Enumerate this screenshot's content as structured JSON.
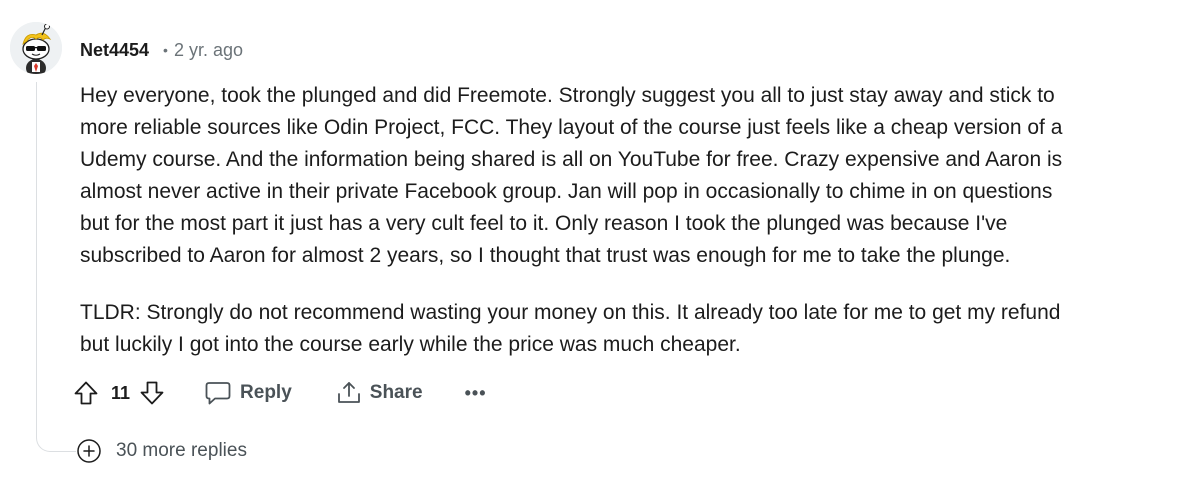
{
  "comment": {
    "username": "Net4454",
    "separator": "•",
    "timestamp": "2 yr. ago",
    "paragraphs": [
      "Hey everyone, took the plunged and did Freemote. Strongly suggest you all to just stay away and stick to\nmore reliable sources like Odin Project, FCC. They layout of the course just feels like a cheap version of a\nUdemy course. And the information being shared is all on YouTube for free. Crazy expensive and Aaron is\nalmost never active in their private Facebook group. Jan will pop in occasionally to chime in on questions\nbut for the most part it just has a very cult feel to it. Only reason I took the plunged was because I've\nsubscribed to Aaron for almost 2 years, so I thought that trust was enough for me to take the plunge.",
      "TLDR: Strongly do not recommend wasting your money on this. It already too late for me to get my refund\nbut luckily I got into the course early while the price was much cheaper."
    ],
    "score": "11"
  },
  "actions": {
    "reply_label": "Reply",
    "share_label": "Share",
    "more_label": "•••"
  },
  "replies": {
    "more_label": "30 more replies"
  },
  "icons": {
    "upvote": "arrow-up-outline-icon",
    "downvote": "arrow-down-outline-icon",
    "reply": "speech-bubble-icon",
    "share": "share-upload-icon",
    "expand": "plus-circle-icon"
  }
}
